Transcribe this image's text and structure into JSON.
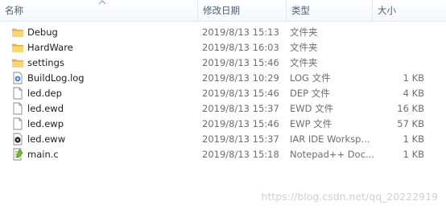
{
  "columns": {
    "name": "名称",
    "date": "修改日期",
    "type": "类型",
    "size": "大小"
  },
  "files": [
    {
      "name": "Debug",
      "date": "2019/8/13 15:13",
      "type": "文件夹",
      "size": "",
      "icon": "folder-icon"
    },
    {
      "name": "HardWare",
      "date": "2019/8/13 16:03",
      "type": "文件夹",
      "size": "",
      "icon": "folder-icon"
    },
    {
      "name": "settings",
      "date": "2019/8/13 15:46",
      "type": "文件夹",
      "size": "",
      "icon": "folder-icon"
    },
    {
      "name": "BuildLog.log",
      "date": "2019/8/13 10:29",
      "type": "LOG 文件",
      "size": "1 KB",
      "icon": "log-file-icon"
    },
    {
      "name": "led.dep",
      "date": "2019/8/13 15:46",
      "type": "DEP 文件",
      "size": "4 KB",
      "icon": "file-icon"
    },
    {
      "name": "led.ewd",
      "date": "2019/8/13 15:37",
      "type": "EWD 文件",
      "size": "16 KB",
      "icon": "file-icon"
    },
    {
      "name": "led.ewp",
      "date": "2019/8/13 15:46",
      "type": "EWP 文件",
      "size": "57 KB",
      "icon": "file-icon"
    },
    {
      "name": "led.eww",
      "date": "2019/8/13 15:37",
      "type": "IAR IDE Worksp...",
      "size": "1 KB",
      "icon": "iar-workspace-icon"
    },
    {
      "name": "main.c",
      "date": "2019/8/13 15:18",
      "type": "Notepad++ Doc...",
      "size": "1 KB",
      "icon": "notepad-file-icon"
    }
  ],
  "watermark": "https://blog.csdn.net/qq_20222919"
}
